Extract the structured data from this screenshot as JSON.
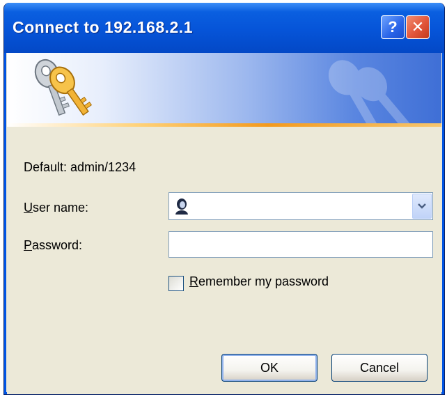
{
  "window": {
    "title": "Connect to 192.168.2.1",
    "help_glyph": "?",
    "close_glyph": "✕"
  },
  "banner": {
    "icon": "keys-icon"
  },
  "form": {
    "default_text": "Default: admin/1234",
    "username": {
      "label_underlined": "U",
      "label_rest": "ser name:",
      "value": "",
      "icon": "user-icon"
    },
    "password": {
      "label_underlined": "P",
      "label_rest": "assword:",
      "value": ""
    },
    "remember": {
      "label_underlined": "R",
      "label_rest": "emember my password",
      "checked": false
    }
  },
  "buttons": {
    "ok": "OK",
    "cancel": "Cancel"
  },
  "colors": {
    "titlebar": "#0654d8",
    "dialog_bg": "#ece9d8",
    "close_button": "#e2553a",
    "banner_accent": "#f39a1e"
  }
}
